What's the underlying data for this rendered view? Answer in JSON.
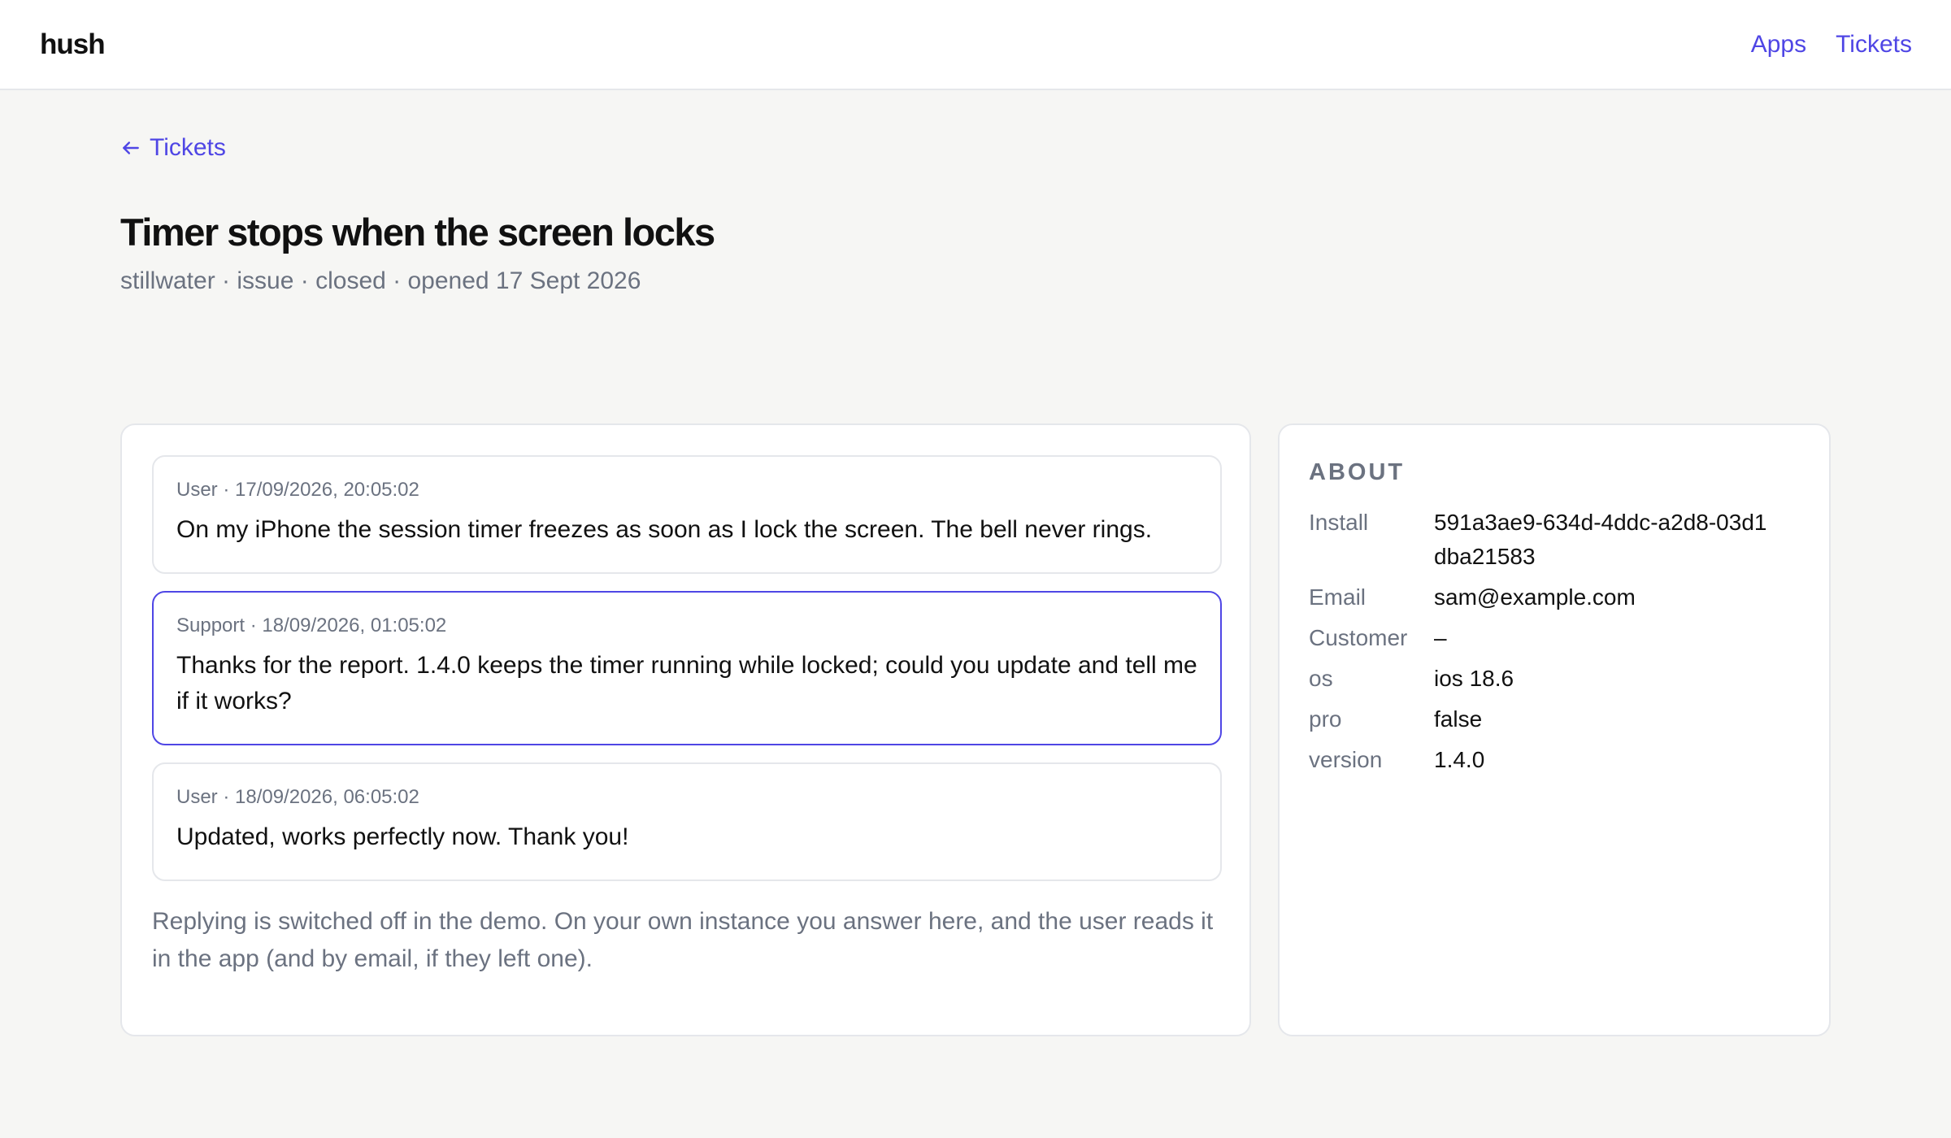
{
  "header": {
    "logo": "hush",
    "nav": [
      "Apps",
      "Tickets"
    ]
  },
  "back_link": "Tickets",
  "ticket": {
    "title": "Timer stops when the screen locks",
    "meta": [
      "stillwater",
      "issue",
      "closed",
      "opened 17 Sept 2026"
    ]
  },
  "messages": [
    {
      "author": "User",
      "timestamp": "17/09/2026, 20:05:02",
      "head": "User · 17/09/2026, 20:05:02",
      "body": "On my iPhone the session timer freezes as soon as I lock the screen. The bell never rings."
    },
    {
      "author": "Support",
      "timestamp": "18/09/2026, 01:05:02",
      "head": "Support · 18/09/2026, 01:05:02",
      "body": "Thanks for the report. 1.4.0 keeps the timer running while locked; could you update and tell me if it works?"
    },
    {
      "author": "User",
      "timestamp": "18/09/2026, 06:05:02",
      "head": "User · 18/09/2026, 06:05:02",
      "body": "Updated, works perfectly now. Thank you!"
    }
  ],
  "reply_note": "Replying is switched off in the demo. On your own instance you answer here, and the user reads it in the app (and by email, if they left one).",
  "about": {
    "title": "ABOUT",
    "rows": [
      {
        "key": "Install",
        "value": "591a3ae9-634d-4ddc-a2d8-03d1dba21583"
      },
      {
        "key": "Email",
        "value": "sam@example.com"
      },
      {
        "key": "Customer",
        "value": "–"
      },
      {
        "key": "os",
        "value": "ios 18.6"
      },
      {
        "key": "pro",
        "value": "false"
      },
      {
        "key": "version",
        "value": "1.4.0"
      }
    ]
  },
  "colors": {
    "accent": "#4f46e5",
    "muted": "#6b7280",
    "background": "#f6f6f4",
    "border": "#e5e7eb"
  }
}
